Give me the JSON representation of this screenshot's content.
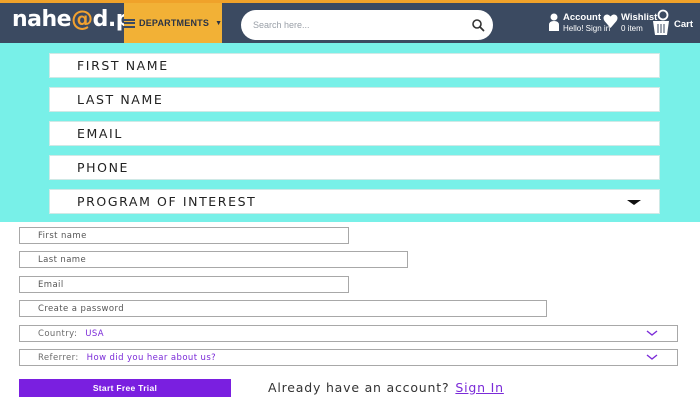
{
  "header": {
    "logo_text_before": "nahe",
    "logo_text_accent": "@",
    "logo_text_after": "d.pk",
    "departments_label": "DEPARTMENTS",
    "search_placeholder": "Search here...",
    "account_title": "Account",
    "account_sub": "Hello! Sign in",
    "wishlist_title": "Wishlist",
    "wishlist_sub": "0 item",
    "cart_label": "Cart"
  },
  "cyan_form": {
    "fields": [
      {
        "label": "FIRST NAME"
      },
      {
        "label": "LAST NAME"
      },
      {
        "label": "EMAIL"
      },
      {
        "label": "PHONE"
      },
      {
        "label": "PROGRAM OF INTEREST"
      }
    ]
  },
  "signup_form": {
    "first_name_placeholder": "First name",
    "last_name_placeholder": "Last name",
    "email_placeholder": "Email",
    "password_placeholder": "Create a password",
    "country_prompt": "Country:",
    "country_value": "USA",
    "referrer_prompt": "Referrer:",
    "referrer_value": "How did you hear about us?",
    "submit_label": "Start Free Trial",
    "signin_prompt": "Already have an account?",
    "signin_link": "Sign In"
  },
  "colors": {
    "header_bg": "#3b4a61",
    "header_accent": "#f0a22a",
    "departments_bg": "#f2b136",
    "cyan_panel": "#78f0e8",
    "purple_accent": "#7a1fe0"
  },
  "icons": [
    "hamburger-icon",
    "search-icon",
    "user-icon",
    "heart-icon",
    "cart-icon",
    "chevron-down-icon"
  ]
}
